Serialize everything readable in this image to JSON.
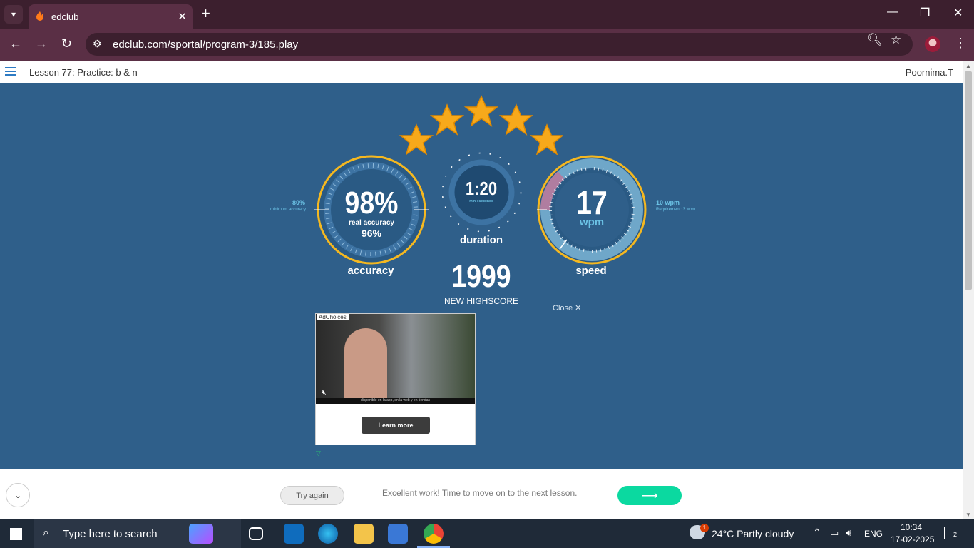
{
  "browser": {
    "tab_title": "edclub",
    "url": "edclub.com/sportal/program-3/185.play",
    "close_tab_glyph": "✕",
    "new_tab_glyph": "+"
  },
  "app": {
    "lesson_title": "Lesson 77: Practice: b & n",
    "user_name": "Poornima.T"
  },
  "results": {
    "stars": 5,
    "accuracy": {
      "value": "98%",
      "real_label": "real accuracy",
      "real_value": "96%",
      "label": "accuracy",
      "minimum_value": "80%",
      "minimum_label": "minimum accuracy"
    },
    "duration": {
      "value": "1:20",
      "unit": "min : seconds",
      "label": "duration"
    },
    "speed": {
      "value": "17",
      "unit": "wpm",
      "label": "speed",
      "requirement_value": "10 wpm",
      "requirement_label": "Requirement: 3 wpm"
    },
    "highscore_value": "1999",
    "highscore_label": "NEW HIGHSCORE",
    "close_label": "Close ✕"
  },
  "ad": {
    "choices_label": "AdChoices",
    "cta_label": "Learn more",
    "caption": "disponible en la app, en la web y en tiendas"
  },
  "footer": {
    "try_again_label": "Try again",
    "message": "Excellent work! Time to move on to the next lesson.",
    "next_arrow": "⟶"
  },
  "taskbar": {
    "search_placeholder": "Type here to search",
    "weather": "24°C  Partly cloudy",
    "weather_badge": "1",
    "language": "ENG",
    "time": "10:34",
    "date": "17-02-2025",
    "notifications_count": "2"
  },
  "colors": {
    "page_bg": "#2f5f8a",
    "gauge_gold": "#f5b820",
    "speed_arc": "#6fa7c9",
    "next_green": "#0bd9a0",
    "titlebar": "#3c1f2e",
    "toolbar": "#5a2f45"
  },
  "icons": [
    "tab-list-icon",
    "edclub-favicon",
    "back-icon",
    "forward-icon",
    "reload-icon",
    "site-info-icon",
    "zoom-icon",
    "bookmark-star-icon",
    "profile-avatar",
    "menu-kebab-icon",
    "hamburger-icon",
    "star-icon",
    "mute-icon",
    "chevron-down-icon",
    "windows-start-icon",
    "search-icon",
    "weather-icon"
  ]
}
